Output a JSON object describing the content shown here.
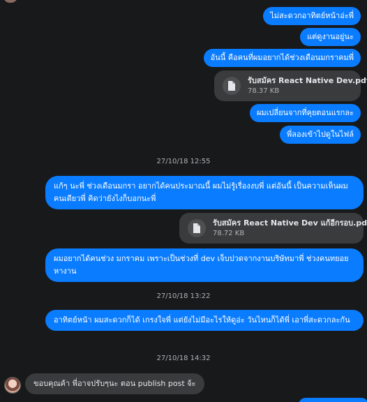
{
  "messages": {
    "m1": "ไม่สะดวกอาทิตย์หน้าอ่ะพี่",
    "m2": "แต่ดูงานอยู่นะ",
    "m3": "อันนี้ คือคนที่ผมอยากได้ช่วงเดือนมกราคมพี่",
    "file1": {
      "name": "รับสมัคร React Native Dev.pdf",
      "size": "78.37 KB"
    },
    "m4": "ผมเปลี่ยนจากที่คุยตอนแรกละ",
    "m5": "พี่ลองเข้าไปดูในไฟล์",
    "ts1": "27/10/18 12:55",
    "m6": "แก้ๆ นะพี่ ช่วงเดือนมกรา อยากได้คนประมาณนี้ ผมไม่รู้เรื่องงบพี่ แต่อันนี้ เป็นความเห็นผมคนเดียวพี่ คิดว่ายังไงก็บอกนะพี่",
    "file2": {
      "name": "รับสมัคร React Native Dev แก้อีกรอบ.pdf",
      "size": "78.72 KB"
    },
    "m7": "ผมอยากได้คนช่วง มกราคม เพราะเป็นช่วงที่ dev เจ็บปวดจากงานบริษัทมาพี่ ช่วงคนทยอยหางาน",
    "ts2": "27/10/18 13:22",
    "m8": "อาทิตย์หน้า ผมสะดวกก็ได้ เกรงใจพี่ แต่ยังไม่มีอะไรให้ดูอ่ะ วันไหนก็ได้พี่ เอาพี่สะดวกละกัน",
    "ts3": "27/10/18 14:32",
    "m9": "ขอบคุณค้า พี่อาจปรับๆนะ ตอน publish post จ้ะ"
  },
  "colors": {
    "background": "#18191a",
    "outgoing_bubble": "#0a7cff",
    "incoming_bubble": "#3a3b3c",
    "timestamp": "#b0b3b8"
  },
  "icons": {
    "file": "file-icon",
    "avatar": "avatar"
  }
}
